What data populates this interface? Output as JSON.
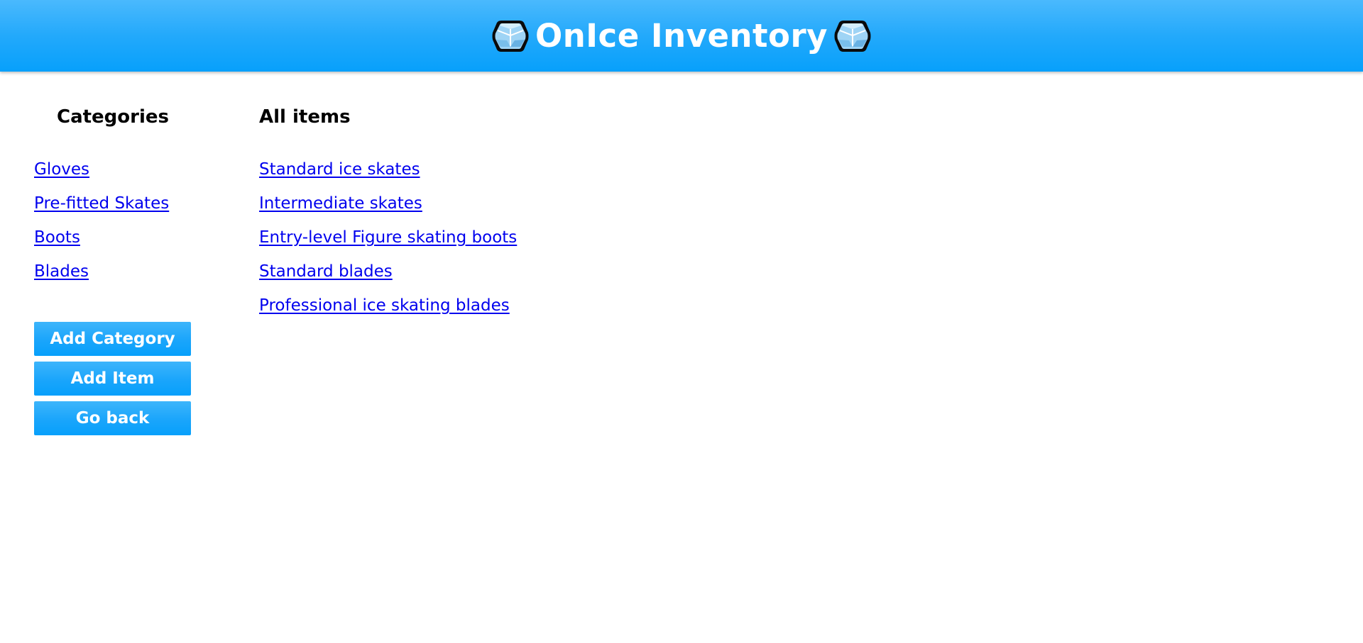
{
  "header": {
    "title": "OnIce Inventory",
    "icon_left": "ice-cube-icon",
    "icon_right": "ice-cube-icon",
    "background_color": "#1aa5fb"
  },
  "sidebar": {
    "heading": "Categories",
    "categories": [
      {
        "label": "Gloves"
      },
      {
        "label": "Pre-fitted Skates"
      },
      {
        "label": "Boots"
      },
      {
        "label": "Blades"
      }
    ],
    "buttons": {
      "add_category": "Add Category",
      "add_item": "Add Item",
      "go_back": "Go back"
    }
  },
  "main": {
    "heading": "All items",
    "items": [
      {
        "label": "Standard ice skates"
      },
      {
        "label": "Intermediate skates"
      },
      {
        "label": "Entry-level Figure skating boots"
      },
      {
        "label": "Standard blades"
      },
      {
        "label": "Professional ice skating blades"
      }
    ]
  },
  "colors": {
    "link": "#0000ee",
    "button": "#1aa5fb",
    "button_text": "#ffffff"
  }
}
